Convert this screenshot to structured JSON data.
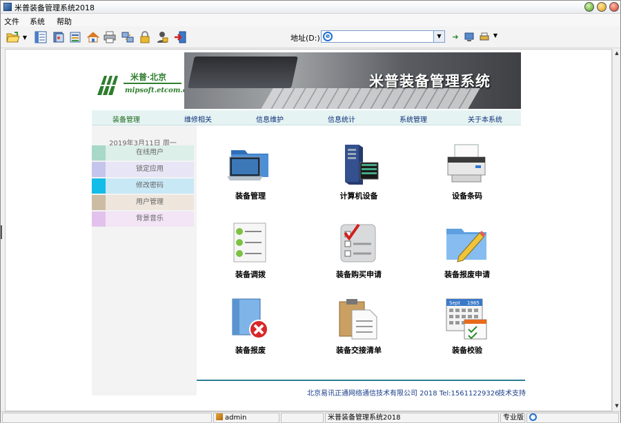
{
  "window": {
    "title": "米普装备管理系统2018"
  },
  "menubar": {
    "items": [
      "文件",
      "系统",
      "帮助"
    ]
  },
  "toolbar": {
    "icons": [
      "open-folder-icon",
      "list-view-icon",
      "book-icon",
      "folder-tree-icon",
      "home-icon",
      "print-icon",
      "network-icon",
      "lock-icon",
      "user-lock-icon",
      "exit-icon"
    ],
    "address_label": "地址(D:)",
    "address_value": ""
  },
  "banner": {
    "logo_cn": "米普·北京",
    "logo_en": "mipsoft.etcom.cn",
    "title": "米普装备管理系统"
  },
  "nav": {
    "items": [
      "装备管理",
      "维修相关",
      "信息维护",
      "信息统计",
      "系统管理",
      "关于本系统"
    ]
  },
  "sidebar": {
    "date": "2019年3月11日  周一",
    "items": [
      {
        "label": "在线用户",
        "color": "#a8d8c8",
        "bg": "#dcefe9"
      },
      {
        "label": "锁定应用",
        "color": "#c4c4ec",
        "bg": "#e8e6f6"
      },
      {
        "label": "修改密码",
        "color": "#14bde8",
        "bg": "#c9e8f6"
      },
      {
        "label": "用户管理",
        "color": "#cdbca4",
        "bg": "#eee6dc"
      },
      {
        "label": "背景音乐",
        "color": "#e2c2ec",
        "bg": "#f3e4f6"
      }
    ]
  },
  "modules": [
    {
      "label": "装备管理",
      "icon": "laptop-folder-icon"
    },
    {
      "label": "计算机设备",
      "icon": "server-icon"
    },
    {
      "label": "设备条码",
      "icon": "printer-icon"
    },
    {
      "label": "装备调拨",
      "icon": "checklist-icon"
    },
    {
      "label": "装备购买申请",
      "icon": "checkbox-form-icon"
    },
    {
      "label": "装备报废申请",
      "icon": "folder-pencil-icon"
    },
    {
      "label": "装备报废",
      "icon": "delete-document-icon"
    },
    {
      "label": "装备交接清单",
      "icon": "clipboard-icon"
    },
    {
      "label": "装备校验",
      "icon": "calendar-icon"
    }
  ],
  "calendar_icon": {
    "month": "Sept",
    "year": "1985"
  },
  "footer": {
    "company": "北京易讯正通网络通信技术有限公司 2018  Tel:15611229326",
    "support": "技术支持"
  },
  "statusbar": {
    "user": "admin",
    "app": "米普装备管理系统2018",
    "edition": "专业版"
  }
}
